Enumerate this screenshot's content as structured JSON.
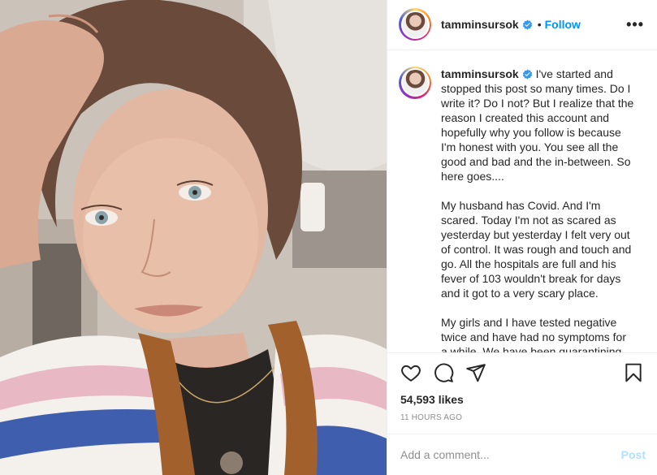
{
  "post": {
    "username": "tamminsursok",
    "follow_label": "Follow",
    "separator": "•",
    "more_label": "•••",
    "caption_paragraphs": [
      "I've started and stopped this post so many times. Do I write it? Do I not? But I realize that the reason I created this account and hopefully why you follow is because I'm honest with you. You see all the good and bad and the in-between. So here goes....",
      "My husband has Covid. And I'm scared. Today I'm not as scared as yesterday but yesterday I felt very out of control. It was rough and touch and go. All the hospitals are full and his fever of 103 wouldn't break for days and it got to a very scary place.",
      "My girls and I have tested negative twice and have had no symptoms for a while. We have been quarantining"
    ],
    "likes": "54,593 likes",
    "time_ago": "11 HOURS AGO",
    "comment_placeholder": "Add a comment...",
    "post_button": "Post"
  },
  "icons": {
    "verified": "verified-badge-icon",
    "like": "heart-icon",
    "comment": "comment-icon",
    "share": "share-icon",
    "save": "bookmark-icon"
  },
  "colors": {
    "link_blue": "#0095f6",
    "verified_blue": "#3897f0",
    "muted": "#8e8e8e",
    "post_disabled": "#b2dffc"
  }
}
